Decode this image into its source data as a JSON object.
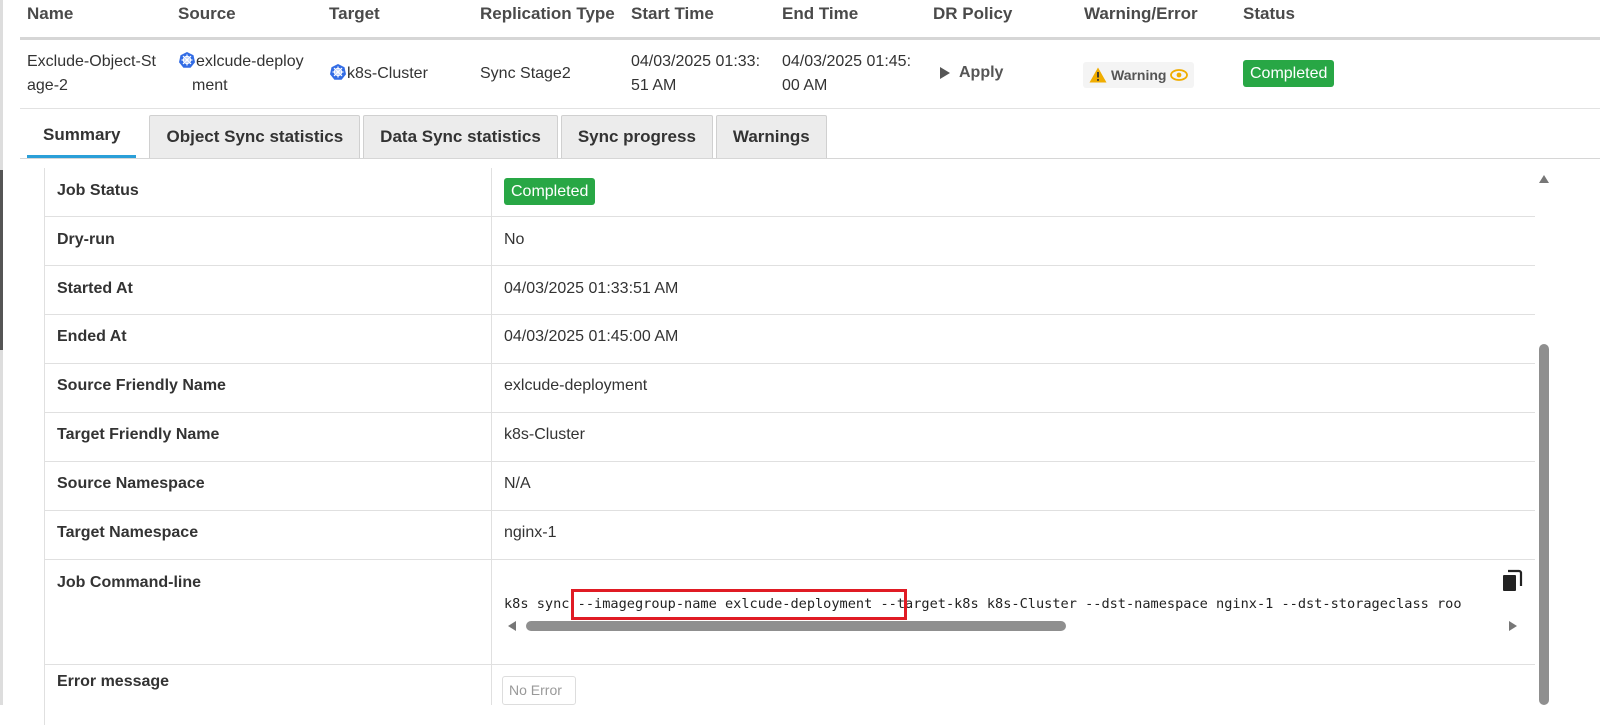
{
  "columns": {
    "name": "Name",
    "source": "Source",
    "target": "Target",
    "replication_type": "Replication Type",
    "start_time": "Start Time",
    "end_time": "End Time",
    "dr_policy": "DR Policy",
    "warning_error": "Warning/Error",
    "status": "Status"
  },
  "row": {
    "name_l1": "Exclude-Object-St",
    "name_l2": "age-2",
    "source_l1": "exlcude-deploy",
    "source_l2": "ment",
    "target": "k8s-Cluster",
    "replication_type": "Sync Stage2",
    "start_l1": "04/03/2025 01:33:",
    "start_l2": "51 AM",
    "end_l1": "04/03/2025 01:45:",
    "end_l2": "00 AM",
    "dr_policy": "Apply",
    "warning": "Warning",
    "status": "Completed"
  },
  "tabs": [
    "Summary",
    "Object Sync statistics",
    "Data Sync statistics",
    "Sync progress",
    "Warnings"
  ],
  "summary": {
    "job_status_label": "Job Status",
    "job_status_value": "Completed",
    "dry_run_label": "Dry-run",
    "dry_run_value": "No",
    "started_label": "Started At",
    "started_value": "04/03/2025 01:33:51 AM",
    "ended_label": "Ended At",
    "ended_value": "04/03/2025 01:45:00 AM",
    "src_friendly_label": "Source Friendly Name",
    "src_friendly_value": "exlcude-deployment",
    "tgt_friendly_label": "Target Friendly Name",
    "tgt_friendly_value": "k8s-Cluster",
    "src_ns_label": "Source Namespace",
    "src_ns_value": "N/A",
    "tgt_ns_label": "Target Namespace",
    "tgt_ns_value": "nginx-1",
    "cmdline_label": "Job Command-line",
    "cmdline_value": "k8s sync --imagegroup-name exlcude-deployment --target-k8s k8s-Cluster --dst-namespace nginx-1 --dst-storageclass roo",
    "error_label": "Error message",
    "error_value": "No Error"
  },
  "colors": {
    "success": "#28a745",
    "tab_active_accent": "#2a9fd8",
    "warning_icon": "#f0ad00",
    "highlight_box": "#e01b24"
  },
  "icons": [
    "kubernetes-icon",
    "play-icon",
    "warning-triangle-icon",
    "eye-icon",
    "copy-icon",
    "scroll-arrow-icons"
  ]
}
